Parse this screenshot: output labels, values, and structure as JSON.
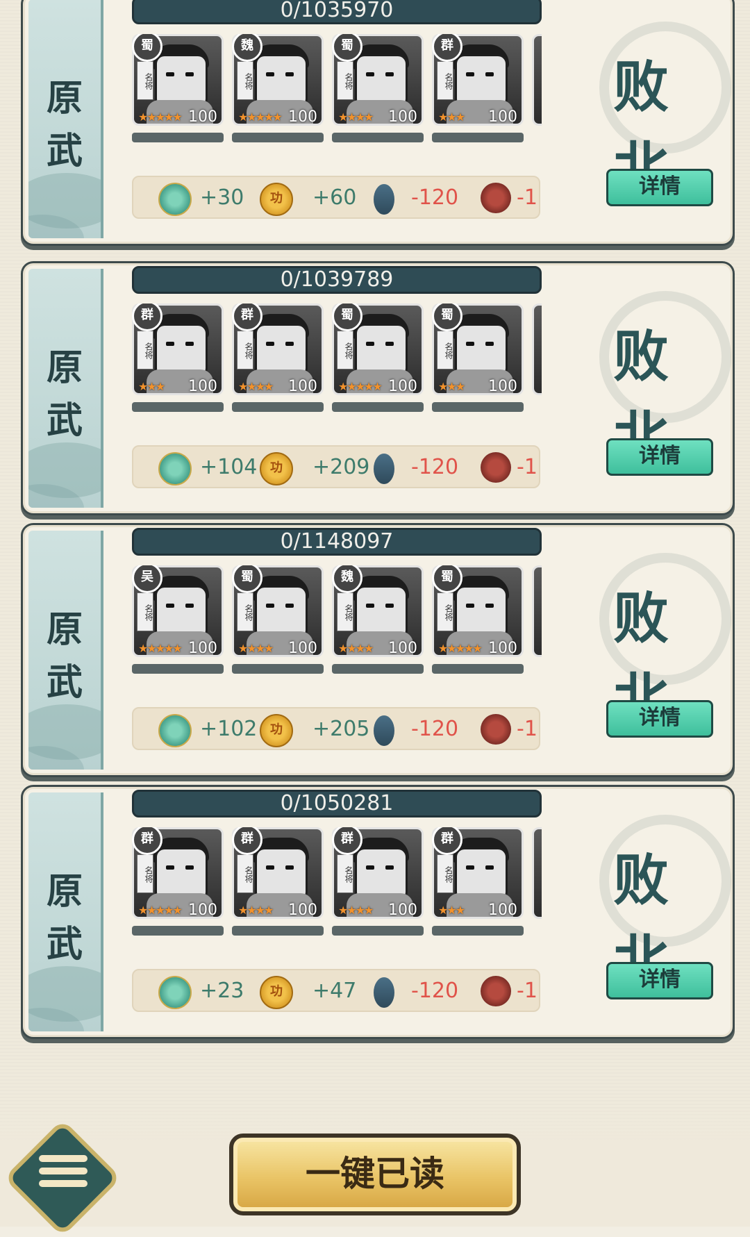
{
  "records": [
    {
      "side_label_top": "原",
      "side_label_bottom": "武",
      "hp_text": "0/1035970",
      "result": "败北",
      "detail_label": "详情",
      "heroes": [
        {
          "faction": "蜀",
          "tag": "名将",
          "stars": "★★★★★",
          "level": "100"
        },
        {
          "faction": "魏",
          "tag": "名将",
          "stars": "★★★★★",
          "level": "100"
        },
        {
          "faction": "蜀",
          "tag": "名将",
          "stars": "★★★★",
          "level": "100"
        },
        {
          "faction": "群",
          "tag": "名将",
          "stars": "★★★",
          "level": "100"
        }
      ],
      "rewards": {
        "jade": "+30",
        "merit": "+60",
        "soldiers": "-120",
        "cannon": "-1"
      }
    },
    {
      "side_label_top": "原",
      "side_label_bottom": "武",
      "hp_text": "0/1039789",
      "result": "败北",
      "detail_label": "详情",
      "heroes": [
        {
          "faction": "群",
          "tag": "名将",
          "stars": "★★★",
          "level": "100"
        },
        {
          "faction": "群",
          "tag": "名将",
          "stars": "★★★★",
          "level": "100"
        },
        {
          "faction": "蜀",
          "tag": "名将",
          "stars": "★★★★★",
          "level": "100"
        },
        {
          "faction": "蜀",
          "tag": "名将",
          "stars": "★★★",
          "level": "100"
        }
      ],
      "rewards": {
        "jade": "+104",
        "merit": "+209",
        "soldiers": "-120",
        "cannon": "-1"
      }
    },
    {
      "side_label_top": "原",
      "side_label_bottom": "武",
      "hp_text": "0/1148097",
      "result": "败北",
      "detail_label": "详情",
      "heroes": [
        {
          "faction": "吴",
          "tag": "名将",
          "stars": "★★★★★",
          "level": "100"
        },
        {
          "faction": "蜀",
          "tag": "名将",
          "stars": "★★★★",
          "level": "100"
        },
        {
          "faction": "魏",
          "tag": "名将",
          "stars": "★★★★",
          "level": "100"
        },
        {
          "faction": "蜀",
          "tag": "名将",
          "stars": "★★★★★",
          "level": "100"
        }
      ],
      "rewards": {
        "jade": "+102",
        "merit": "+205",
        "soldiers": "-120",
        "cannon": "-1"
      }
    },
    {
      "side_label_top": "原",
      "side_label_bottom": "武",
      "hp_text": "0/1050281",
      "result": "败北",
      "detail_label": "详情",
      "heroes": [
        {
          "faction": "群",
          "tag": "名将",
          "stars": "★★★★★",
          "level": "100"
        },
        {
          "faction": "群",
          "tag": "名将",
          "stars": "★★★★",
          "level": "100"
        },
        {
          "faction": "群",
          "tag": "名将",
          "stars": "★★★★",
          "level": "100"
        },
        {
          "faction": "群",
          "tag": "名将",
          "stars": "★★★",
          "level": "100"
        }
      ],
      "rewards": {
        "jade": "+23",
        "merit": "+47",
        "soldiers": "-120",
        "cannon": "-1"
      }
    }
  ],
  "icons": {
    "jade": "jade-coin-icon",
    "merit": "merit-coin-icon",
    "merit_glyph": "功",
    "soldiers": "soldier-icon",
    "cannon": "cannon-icon",
    "menu": "menu-icon"
  },
  "colors": {
    "loss_text": "#2b5557",
    "negative": "#e0534a",
    "positive": "#3d7b6b",
    "detail_button": "#4fcfac",
    "read_all_button": "#e9c466"
  },
  "footer": {
    "read_all_label": "一键已读"
  }
}
